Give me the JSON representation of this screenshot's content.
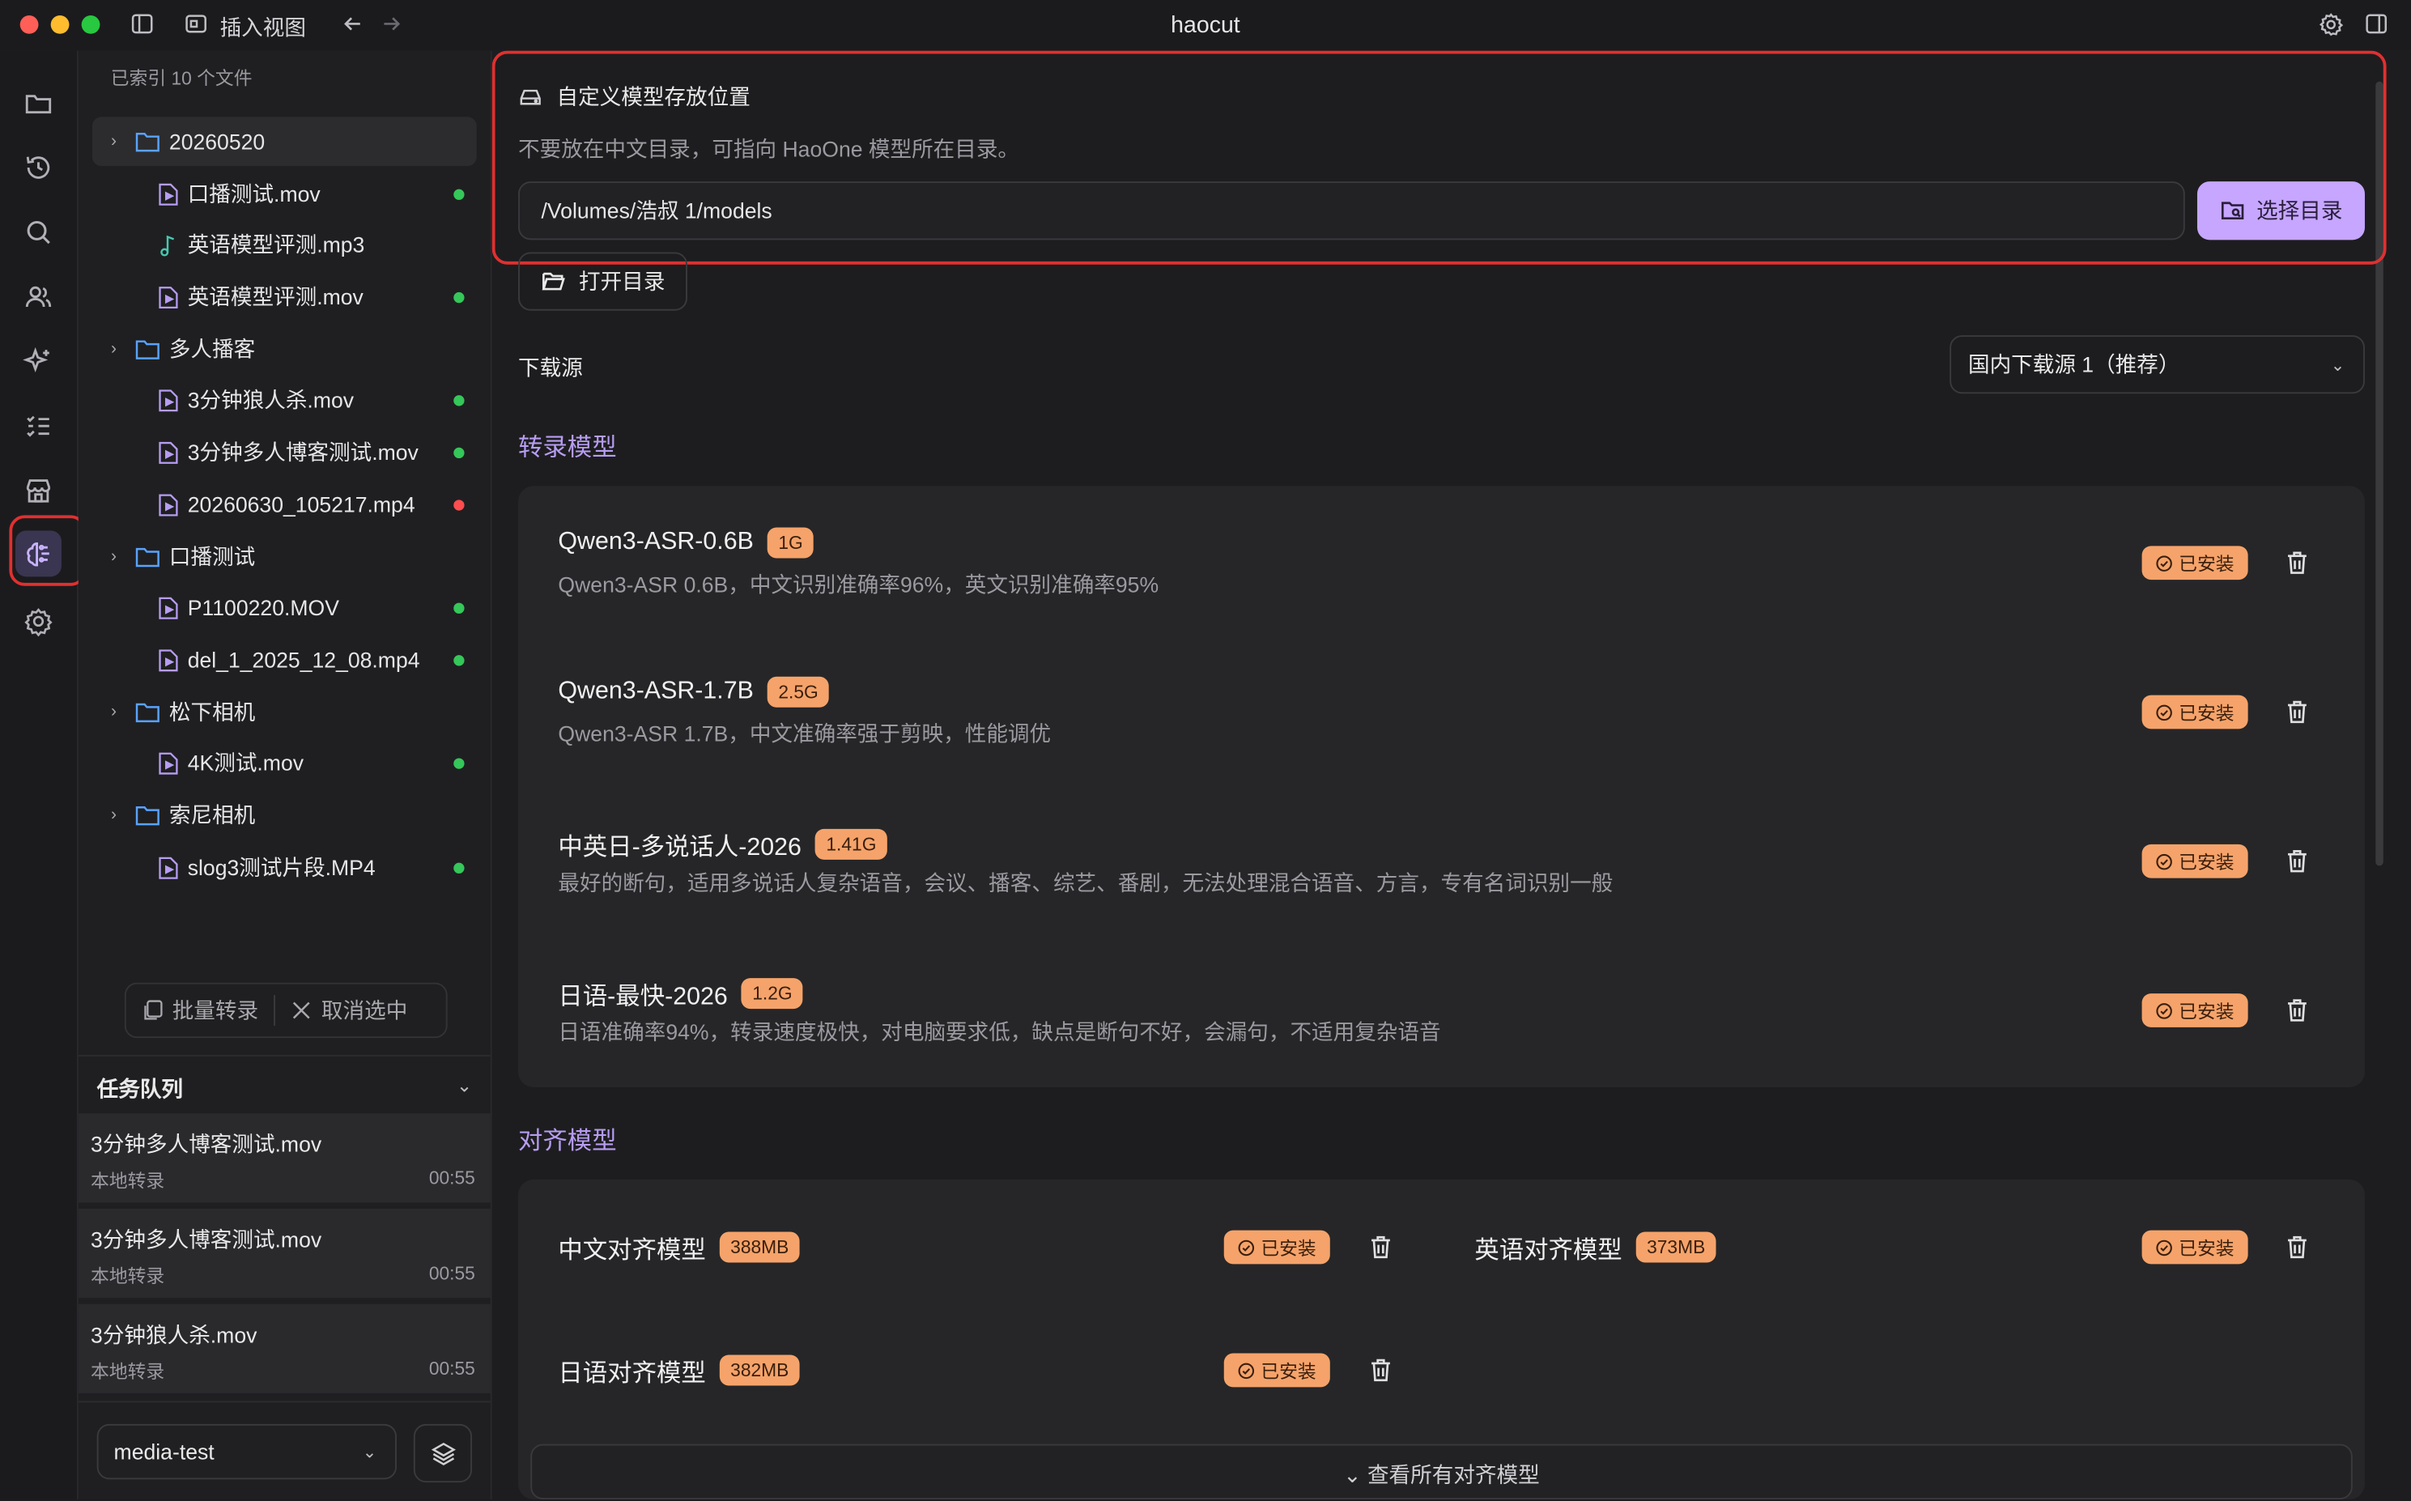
{
  "window": {
    "title": "haocut",
    "insert_view": "插入视图"
  },
  "sidebar": {
    "indexed_label": "已索引 10 个文件",
    "tree": [
      {
        "type": "folder",
        "label": "20260520",
        "selected": true
      },
      {
        "type": "video",
        "label": "口播测试.mov",
        "status": "green"
      },
      {
        "type": "audio",
        "label": "英语模型评测.mp3",
        "status": ""
      },
      {
        "type": "video",
        "label": "英语模型评测.mov",
        "status": "green"
      },
      {
        "type": "folder",
        "label": "多人播客"
      },
      {
        "type": "video",
        "label": "3分钟狼人杀.mov",
        "status": "green"
      },
      {
        "type": "video",
        "label": "3分钟多人博客测试.mov",
        "status": "green"
      },
      {
        "type": "video",
        "label": "20260630_105217.mp4",
        "status": "red"
      },
      {
        "type": "folder",
        "label": "口播测试"
      },
      {
        "type": "video",
        "label": "P1100220.MOV",
        "status": "green"
      },
      {
        "type": "video",
        "label": "del_1_2025_12_08.mp4",
        "status": "green"
      },
      {
        "type": "folder",
        "label": "松下相机"
      },
      {
        "type": "video",
        "label": "4K测试.mov",
        "status": "green"
      },
      {
        "type": "folder",
        "label": "索尼相机"
      },
      {
        "type": "video",
        "label": "slog3测试片段.MP4",
        "status": "green"
      }
    ],
    "batch_transcribe": "批量转录",
    "cancel_select": "取消选中",
    "queue_title": "任务队列",
    "queue": [
      {
        "name": "3分钟多人博客测试.mov",
        "sub": "本地转录",
        "time": "00:55"
      },
      {
        "name": "3分钟多人博客测试.mov",
        "sub": "本地转录",
        "time": "00:55"
      },
      {
        "name": "3分钟狼人杀.mov",
        "sub": "本地转录",
        "time": "00:55"
      }
    ],
    "project_select": "media-test"
  },
  "main": {
    "storage_title": "自定义模型存放位置",
    "storage_desc": "不要放在中文目录，可指向 HaoOne 模型所在目录。",
    "path_value": "/Volumes/浩叔 1/models",
    "choose_dir": "选择目录",
    "open_dir": "打开目录",
    "download_label": "下载源",
    "download_source": "国内下载源 1（推荐）",
    "transcribe_title": "转录模型",
    "transcribe_models": [
      {
        "name": "Qwen3-ASR-0.6B",
        "size": "1G",
        "desc": "Qwen3-ASR 0.6B，中文识别准确率96%，英文识别准确率95%",
        "status": "已安装"
      },
      {
        "name": "Qwen3-ASR-1.7B",
        "size": "2.5G",
        "desc": "Qwen3-ASR 1.7B，中文准确率强于剪映，性能调优",
        "status": "已安装"
      },
      {
        "name": "中英日-多说话人-2026",
        "size": "1.41G",
        "desc": "最好的断句，适用多说话人复杂语音，会议、播客、综艺、番剧，无法处理混合语音、方言，专有名词识别一般",
        "status": "已安装"
      },
      {
        "name": "日语-最快-2026",
        "size": "1.2G",
        "desc": "日语准确率94%，转录速度极快，对电脑要求低，缺点是断句不好，会漏句，不适用复杂语音",
        "status": "已安装"
      }
    ],
    "align_title": "对齐模型",
    "align_models": [
      {
        "name": "中文对齐模型",
        "size": "388MB",
        "status": "已安装"
      },
      {
        "name": "英语对齐模型",
        "size": "373MB",
        "status": "已安装"
      },
      {
        "name": "日语对齐模型",
        "size": "382MB",
        "status": "已安装"
      }
    ],
    "see_all": "⌄ 查看所有对齐模型"
  }
}
